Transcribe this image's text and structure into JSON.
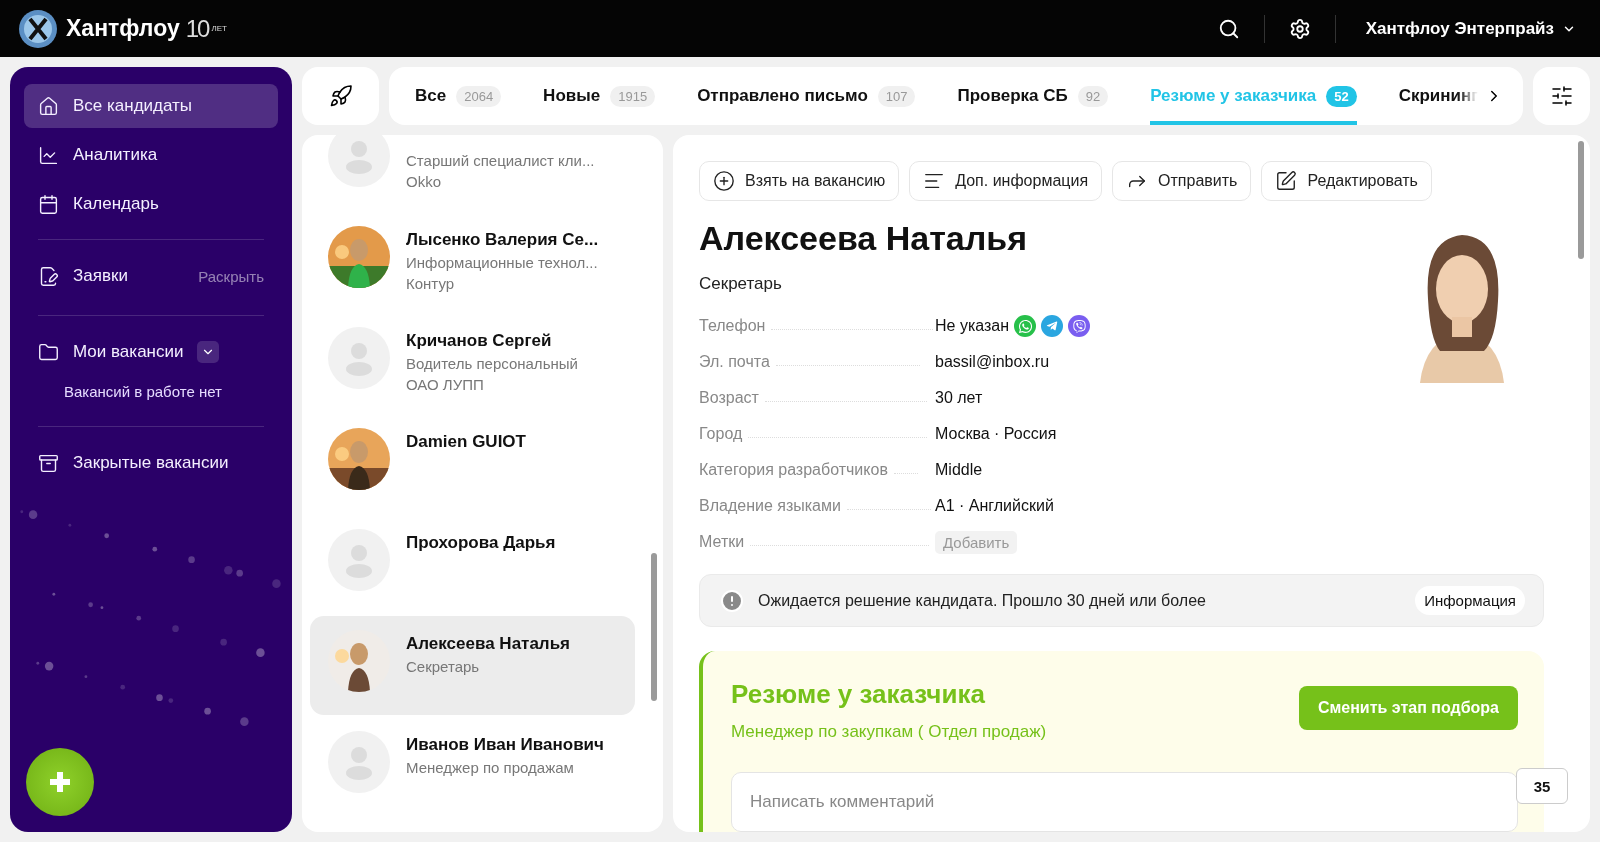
{
  "header": {
    "logo": {
      "name": "Хантфлоу",
      "anniversary_number": "10",
      "anniversary_text": "ЛЕТ"
    },
    "account": "Хантфлоу Энтерпрайз"
  },
  "sidebar": {
    "sections": [
      {
        "items": [
          {
            "label": "Все кандидаты",
            "selected": true
          },
          {
            "label": "Аналитика",
            "selected": false
          },
          {
            "label": "Календарь",
            "selected": false
          }
        ]
      },
      {
        "items": [
          {
            "label": "Заявки",
            "selected": false,
            "action": "Раскрыть"
          }
        ]
      },
      {
        "items": [
          {
            "label": "Мои вакансии",
            "selected": false,
            "dropdown": true
          }
        ],
        "note": "Вакансий в работе нет"
      },
      {
        "items": [
          {
            "label": "Закрытые вакансии",
            "selected": false
          }
        ]
      }
    ]
  },
  "tabs": [
    {
      "label": "Все",
      "count": "2064",
      "selected": false
    },
    {
      "label": "Новые",
      "count": "1915",
      "selected": false
    },
    {
      "label": "Отправлено письмо",
      "count": "107",
      "selected": false
    },
    {
      "label": "Проверка СБ",
      "count": "92",
      "selected": false
    },
    {
      "label": "Резюме у заказчика",
      "count": "52",
      "selected": true
    },
    {
      "label": "Скрининг",
      "selected": false
    }
  ],
  "candidates": [
    {
      "kind": "placeholder",
      "position": "Старший специалист кли...",
      "company": "Okko",
      "selected": false
    },
    {
      "name": "Лысенко Валерия Се...",
      "position": "Информационные технол...",
      "company": "Контур",
      "selected": false
    },
    {
      "kind": "placeholder",
      "name": "Кричанов Сергей",
      "position": "Водитель персональный",
      "company": "ОАО ЛУПП",
      "selected": false
    },
    {
      "name": "Damien GUIOT",
      "selected": false
    },
    {
      "kind": "placeholder",
      "name": "Прохорова Дарья",
      "selected": false
    },
    {
      "name": "Алексеева Наталья",
      "position": "Секретарь",
      "selected": true
    },
    {
      "kind": "placeholder",
      "name": "Иванов Иван Иванович",
      "position": "Менеджер по продажам",
      "selected": false
    }
  ],
  "profile": {
    "actions": [
      {
        "label": "Взять на вакансию"
      },
      {
        "label": "Доп. информация"
      },
      {
        "label": "Отправить"
      },
      {
        "label": "Редактировать"
      }
    ],
    "name": "Алексеева Наталья",
    "position": "Секретарь",
    "fields": [
      {
        "kind": "phone",
        "label": "Телефон",
        "value": "Не указан"
      },
      {
        "kind": "text",
        "label": "Эл. почта",
        "value": "bassil@inbox.ru"
      },
      {
        "kind": "text",
        "label": "Возраст",
        "value": "30 лет"
      },
      {
        "kind": "text",
        "label": "Город",
        "value": "Москва · Россия"
      },
      {
        "kind": "text",
        "label": "Категория разработчиков",
        "value": "Middle"
      },
      {
        "kind": "text",
        "label": "Владение языками",
        "value": "A1 · Английский"
      },
      {
        "kind": "button",
        "label": "Метки",
        "value": "Добавить"
      }
    ],
    "alert": {
      "text": "Ожидается решение кандидата. Прошло 30 дней или более",
      "button": "Информация"
    },
    "stage": {
      "title": "Резюме у заказчика",
      "vacancy": "Менеджер по закупкам ( Отдел продаж)",
      "button": "Сменить этап подбора",
      "comment_placeholder": "Написать комментарий"
    },
    "comments_count": "35"
  }
}
